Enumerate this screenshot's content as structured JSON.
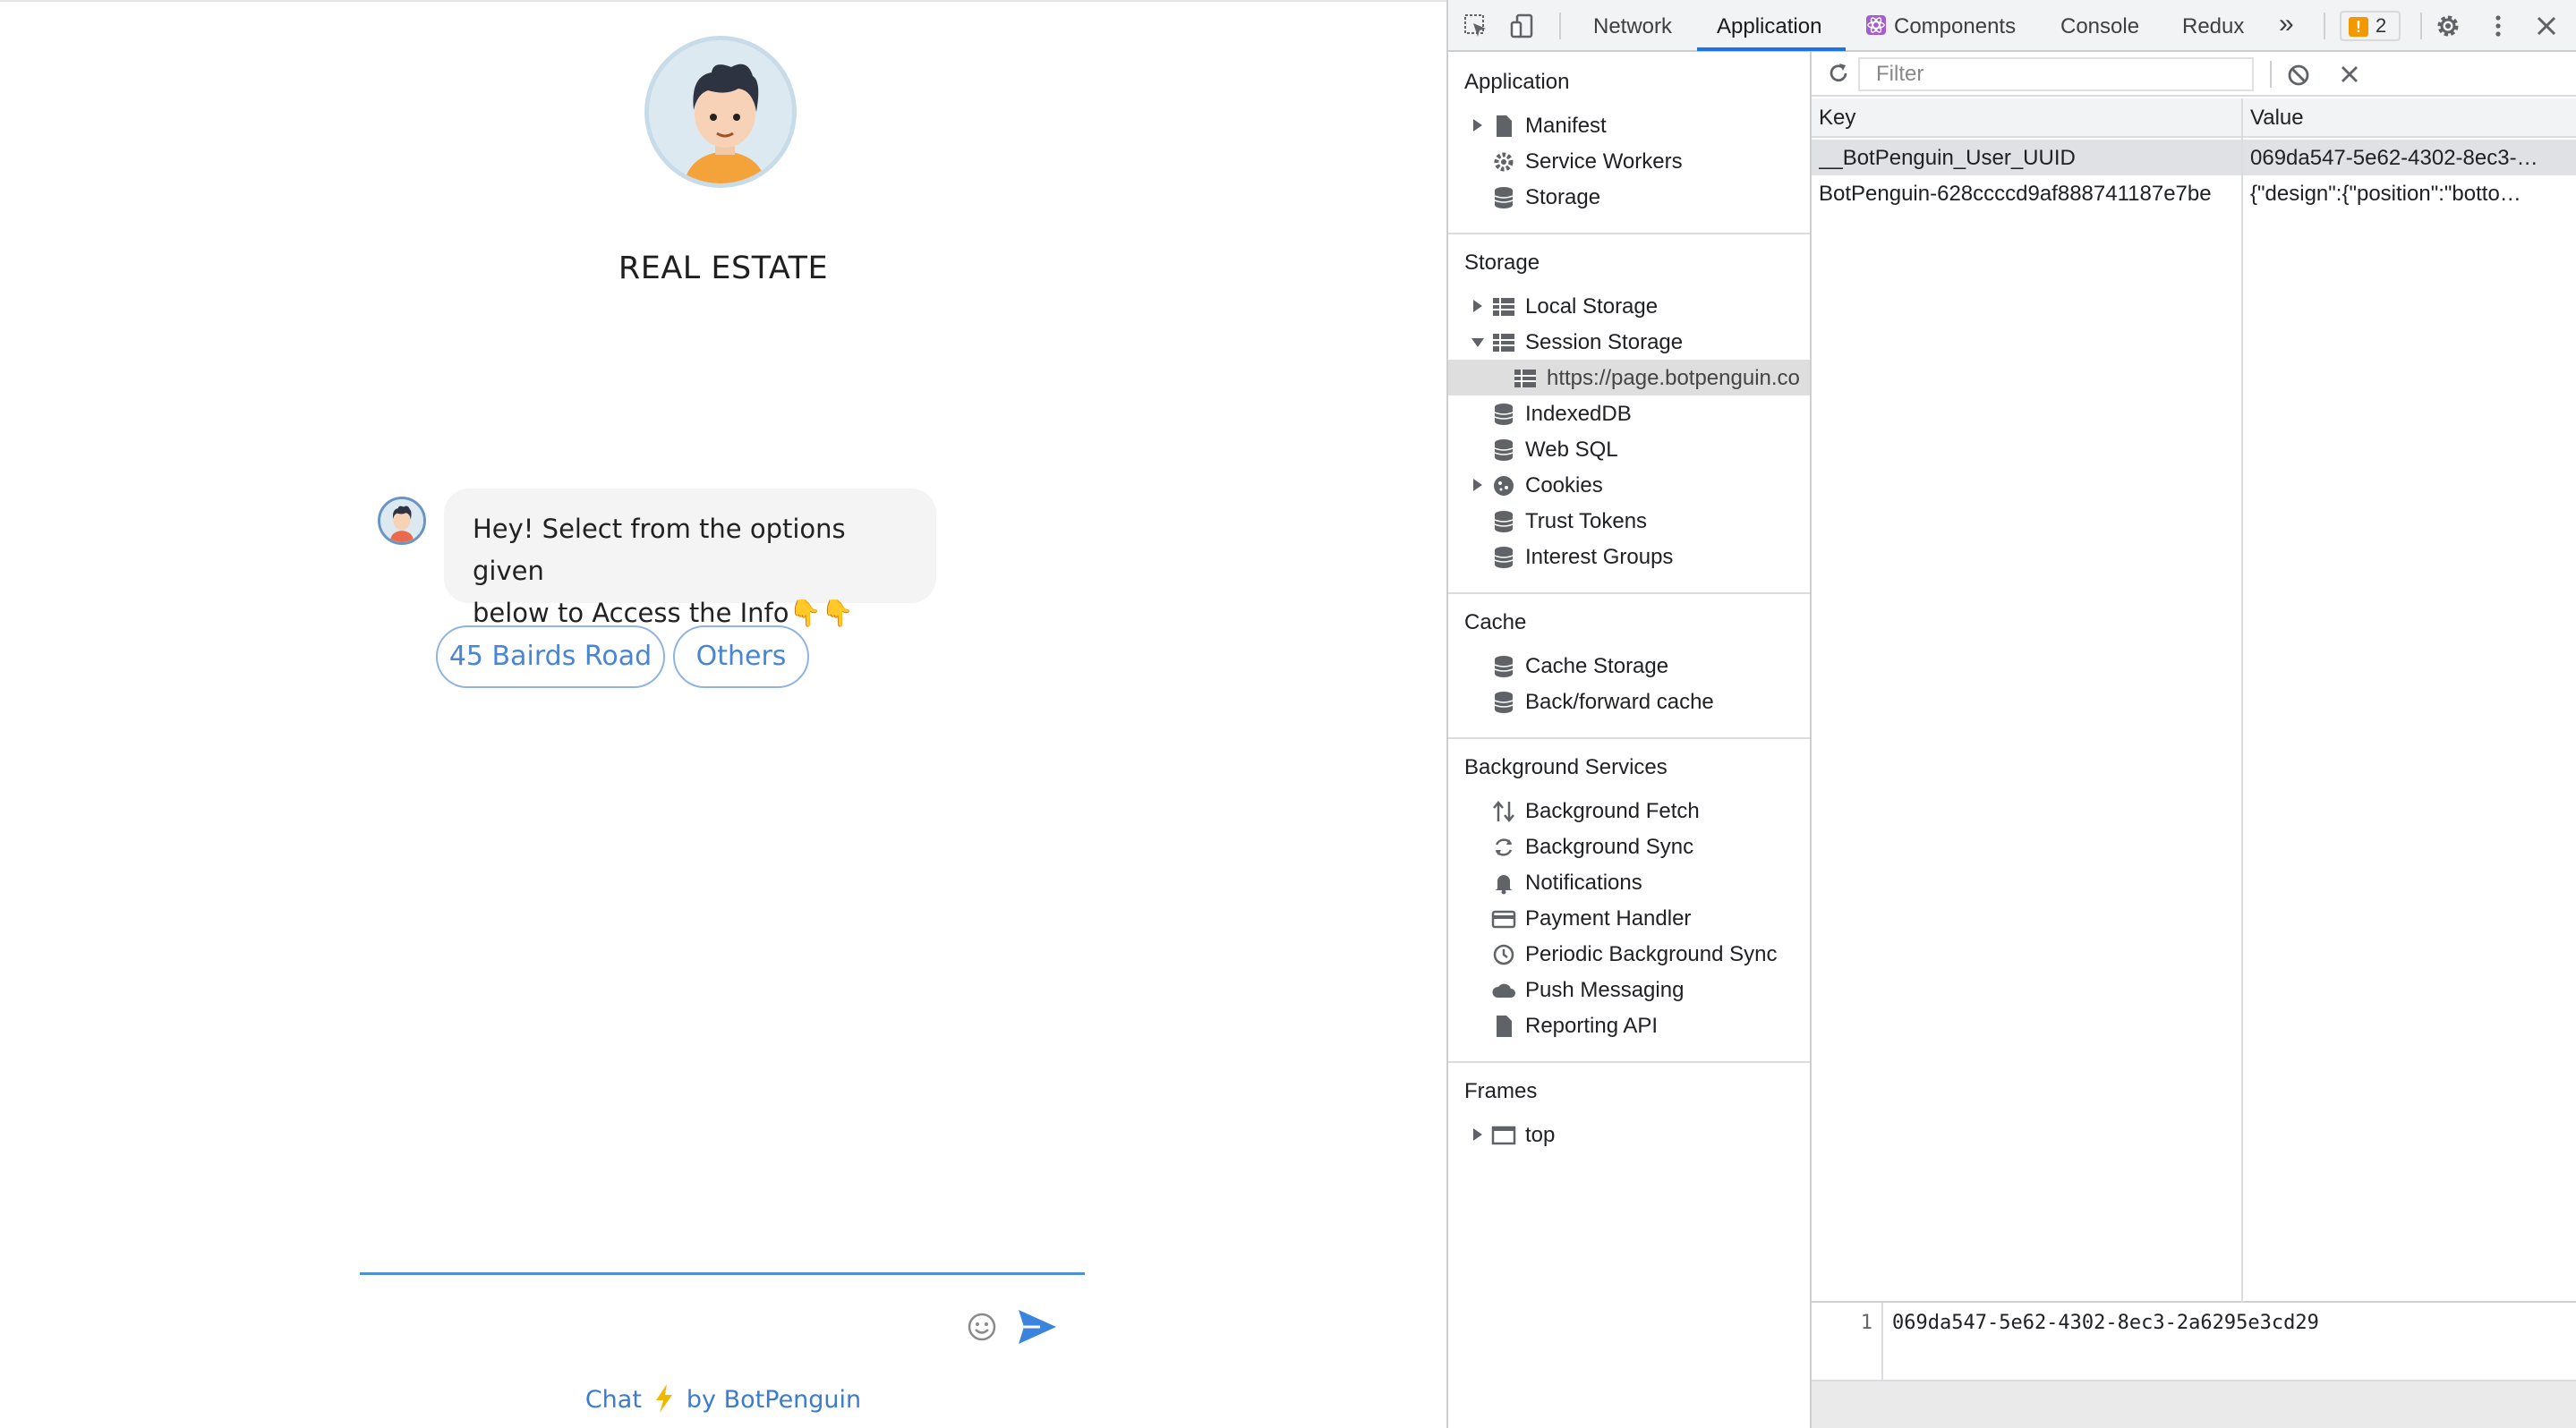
{
  "chat": {
    "bot_name": "REAL ESTATE",
    "message_line1": "Hey! Select from the options given",
    "message_line2": "below to Access the Info",
    "message_emoji": "👇👇",
    "options": [
      "45 Bairds Road",
      "Others"
    ],
    "footer_chat": "Chat",
    "footer_by": "by BotPenguin",
    "accent_color": "#4a85d4"
  },
  "devtools": {
    "tabs": [
      "Network",
      "Application",
      "Components",
      "Console",
      "Redux"
    ],
    "active_tab": "Application",
    "more_tabs_glyph": "»",
    "issues_count": "2",
    "sidebar": {
      "application": {
        "title": "Application",
        "items": [
          "Manifest",
          "Service Workers",
          "Storage"
        ]
      },
      "storage": {
        "title": "Storage",
        "items": [
          "Local Storage",
          "Session Storage",
          "https://page.botpenguin.co",
          "IndexedDB",
          "Web SQL",
          "Cookies",
          "Trust Tokens",
          "Interest Groups"
        ]
      },
      "cache": {
        "title": "Cache",
        "items": [
          "Cache Storage",
          "Back/forward cache"
        ]
      },
      "background": {
        "title": "Background Services",
        "items": [
          "Background Fetch",
          "Background Sync",
          "Notifications",
          "Payment Handler",
          "Periodic Background Sync",
          "Push Messaging",
          "Reporting API"
        ]
      },
      "frames": {
        "title": "Frames",
        "items": [
          "top"
        ]
      }
    },
    "filter_placeholder": "Filter",
    "table": {
      "headers": [
        "Key",
        "Value"
      ],
      "rows": [
        {
          "key": "__BotPenguin_User_UUID",
          "value": "069da547-5e62-4302-8ec3-…"
        },
        {
          "key": "BotPenguin-628ccccd9af888741187e7be",
          "value": "{\"design\":{\"position\":\"botto…"
        }
      ]
    },
    "preview": {
      "line_number": "1",
      "content": "069da547-5e62-4302-8ec3-2a6295e3cd29"
    }
  }
}
